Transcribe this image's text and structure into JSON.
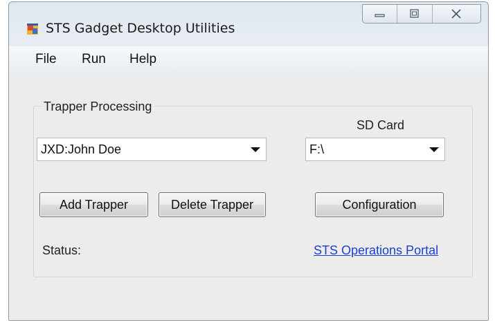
{
  "window": {
    "title": "STS Gadget Desktop Utilities"
  },
  "menu": {
    "items": [
      {
        "label": "File"
      },
      {
        "label": "Run"
      },
      {
        "label": "Help"
      }
    ]
  },
  "trapper_processing": {
    "group_label": "Trapper Processing",
    "trapper_select_value": "JXD:John Doe",
    "sd_card_label": "SD Card",
    "sd_card_value": "F:\\",
    "add_button": "Add Trapper",
    "delete_button": "Delete Trapper",
    "config_button": "Configuration",
    "status_label": "Status:",
    "portal_link": "STS Operations Portal"
  },
  "icons": {
    "app": "app-window-icon",
    "minimize": "minimize-icon",
    "maximize": "maximize-icon",
    "close": "close-icon",
    "dropdown": "chevron-down-icon"
  }
}
